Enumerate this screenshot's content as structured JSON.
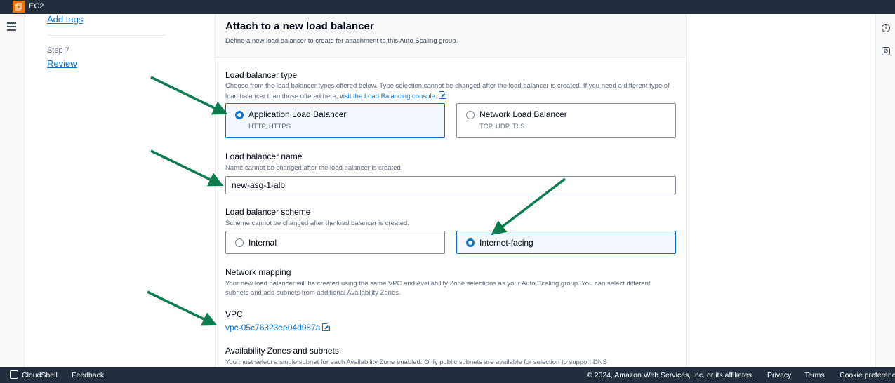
{
  "topbar": {
    "service_name": "EC2"
  },
  "steps": {
    "prev_link": "Add tags",
    "step_label": "Step 7",
    "review_link": "Review"
  },
  "panel": {
    "title": "Attach to a new load balancer",
    "description": "Define a new load balancer to create for attachment to this Auto Scaling group.",
    "lb_type": {
      "label": "Load balancer type",
      "description": "Choose from the load balancer types offered below. Type selection cannot be changed after the load balancer is created. If you need a different type of load balancer than those offered here,",
      "link": "visit the Load Balancing console.",
      "options": [
        {
          "title": "Application Load Balancer",
          "subtitle": "HTTP, HTTPS",
          "selected": true
        },
        {
          "title": "Network Load Balancer",
          "subtitle": "TCP, UDP, TLS",
          "selected": false
        }
      ]
    },
    "lb_name": {
      "label": "Load balancer name",
      "description": "Name cannot be changed after the load balancer is created.",
      "value": "new-asg-1-alb"
    },
    "lb_scheme": {
      "label": "Load balancer scheme",
      "description": "Scheme cannot be changed after the load balancer is created.",
      "options": [
        {
          "title": "Internal",
          "selected": false
        },
        {
          "title": "Internet-facing",
          "selected": true
        }
      ]
    },
    "network_mapping": {
      "label": "Network mapping",
      "description": "Your new load balancer will be created using the same VPC and Availability Zone selections as your Auto Scaling group. You can select different subnets and add subnets from additional Availability Zones."
    },
    "vpc": {
      "label": "VPC",
      "value": "vpc-05c76323ee04d987a"
    },
    "az": {
      "label": "Availability Zones and subnets",
      "description": "You must select a single subnet for each Availability Zone enabled. Only public subnets are available for selection to support DNS"
    }
  },
  "rightrail": {
    "info_icon": "info-icon",
    "settings_icon": "settings-icon"
  },
  "footer": {
    "cloudshell": "CloudShell",
    "feedback": "Feedback",
    "copyright": "© 2024, Amazon Web Services, Inc. or its affiliates.",
    "privacy": "Privacy",
    "terms": "Terms",
    "cookie": "Cookie preferences"
  },
  "colors": {
    "accent": "#0972d3",
    "arrow": "#0a7d4f",
    "topbar": "#232f3e",
    "brand": "#ed7100"
  }
}
